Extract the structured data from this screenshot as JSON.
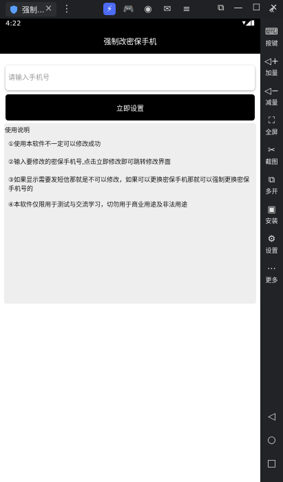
{
  "window": {
    "tab_title": "强制...",
    "tab_close": "×",
    "kebab": "⋮",
    "min": "—",
    "max": "☐",
    "close": "✕",
    "collapse": "«"
  },
  "status_bar": {
    "time": "4:22",
    "right": "▾◢▮"
  },
  "app": {
    "title": "强制改密保手机",
    "phone_placeholder": "请输入手机号",
    "submit_label": "立即设置"
  },
  "instructions": {
    "heading": "使用说明",
    "lines": [
      "①使用本软件不一定可以修改成功",
      "②输入要修改的密保手机号,点击立即修改即可跳转修改界面",
      "③如果显示需要发短信那就是不可以修改，如果可以更换密保手机那就可以强制更换密保手机号的",
      "④本软件仅限用于测试与交流学习，切勿用于商业用途及非法用途"
    ]
  },
  "sidebar": {
    "items": [
      {
        "label": "按键",
        "icon": "keyboard-icon"
      },
      {
        "label": "加量",
        "icon": "volume-up-icon"
      },
      {
        "label": "减量",
        "icon": "volume-down-icon"
      },
      {
        "label": "全屏",
        "icon": "fullscreen-icon"
      },
      {
        "label": "截图",
        "icon": "scissors-icon"
      },
      {
        "label": "多开",
        "icon": "multi-window-icon"
      },
      {
        "label": "安装",
        "icon": "apk-install-icon"
      },
      {
        "label": "设置",
        "icon": "gear-icon"
      },
      {
        "label": "更多",
        "icon": "more-icon"
      }
    ]
  }
}
